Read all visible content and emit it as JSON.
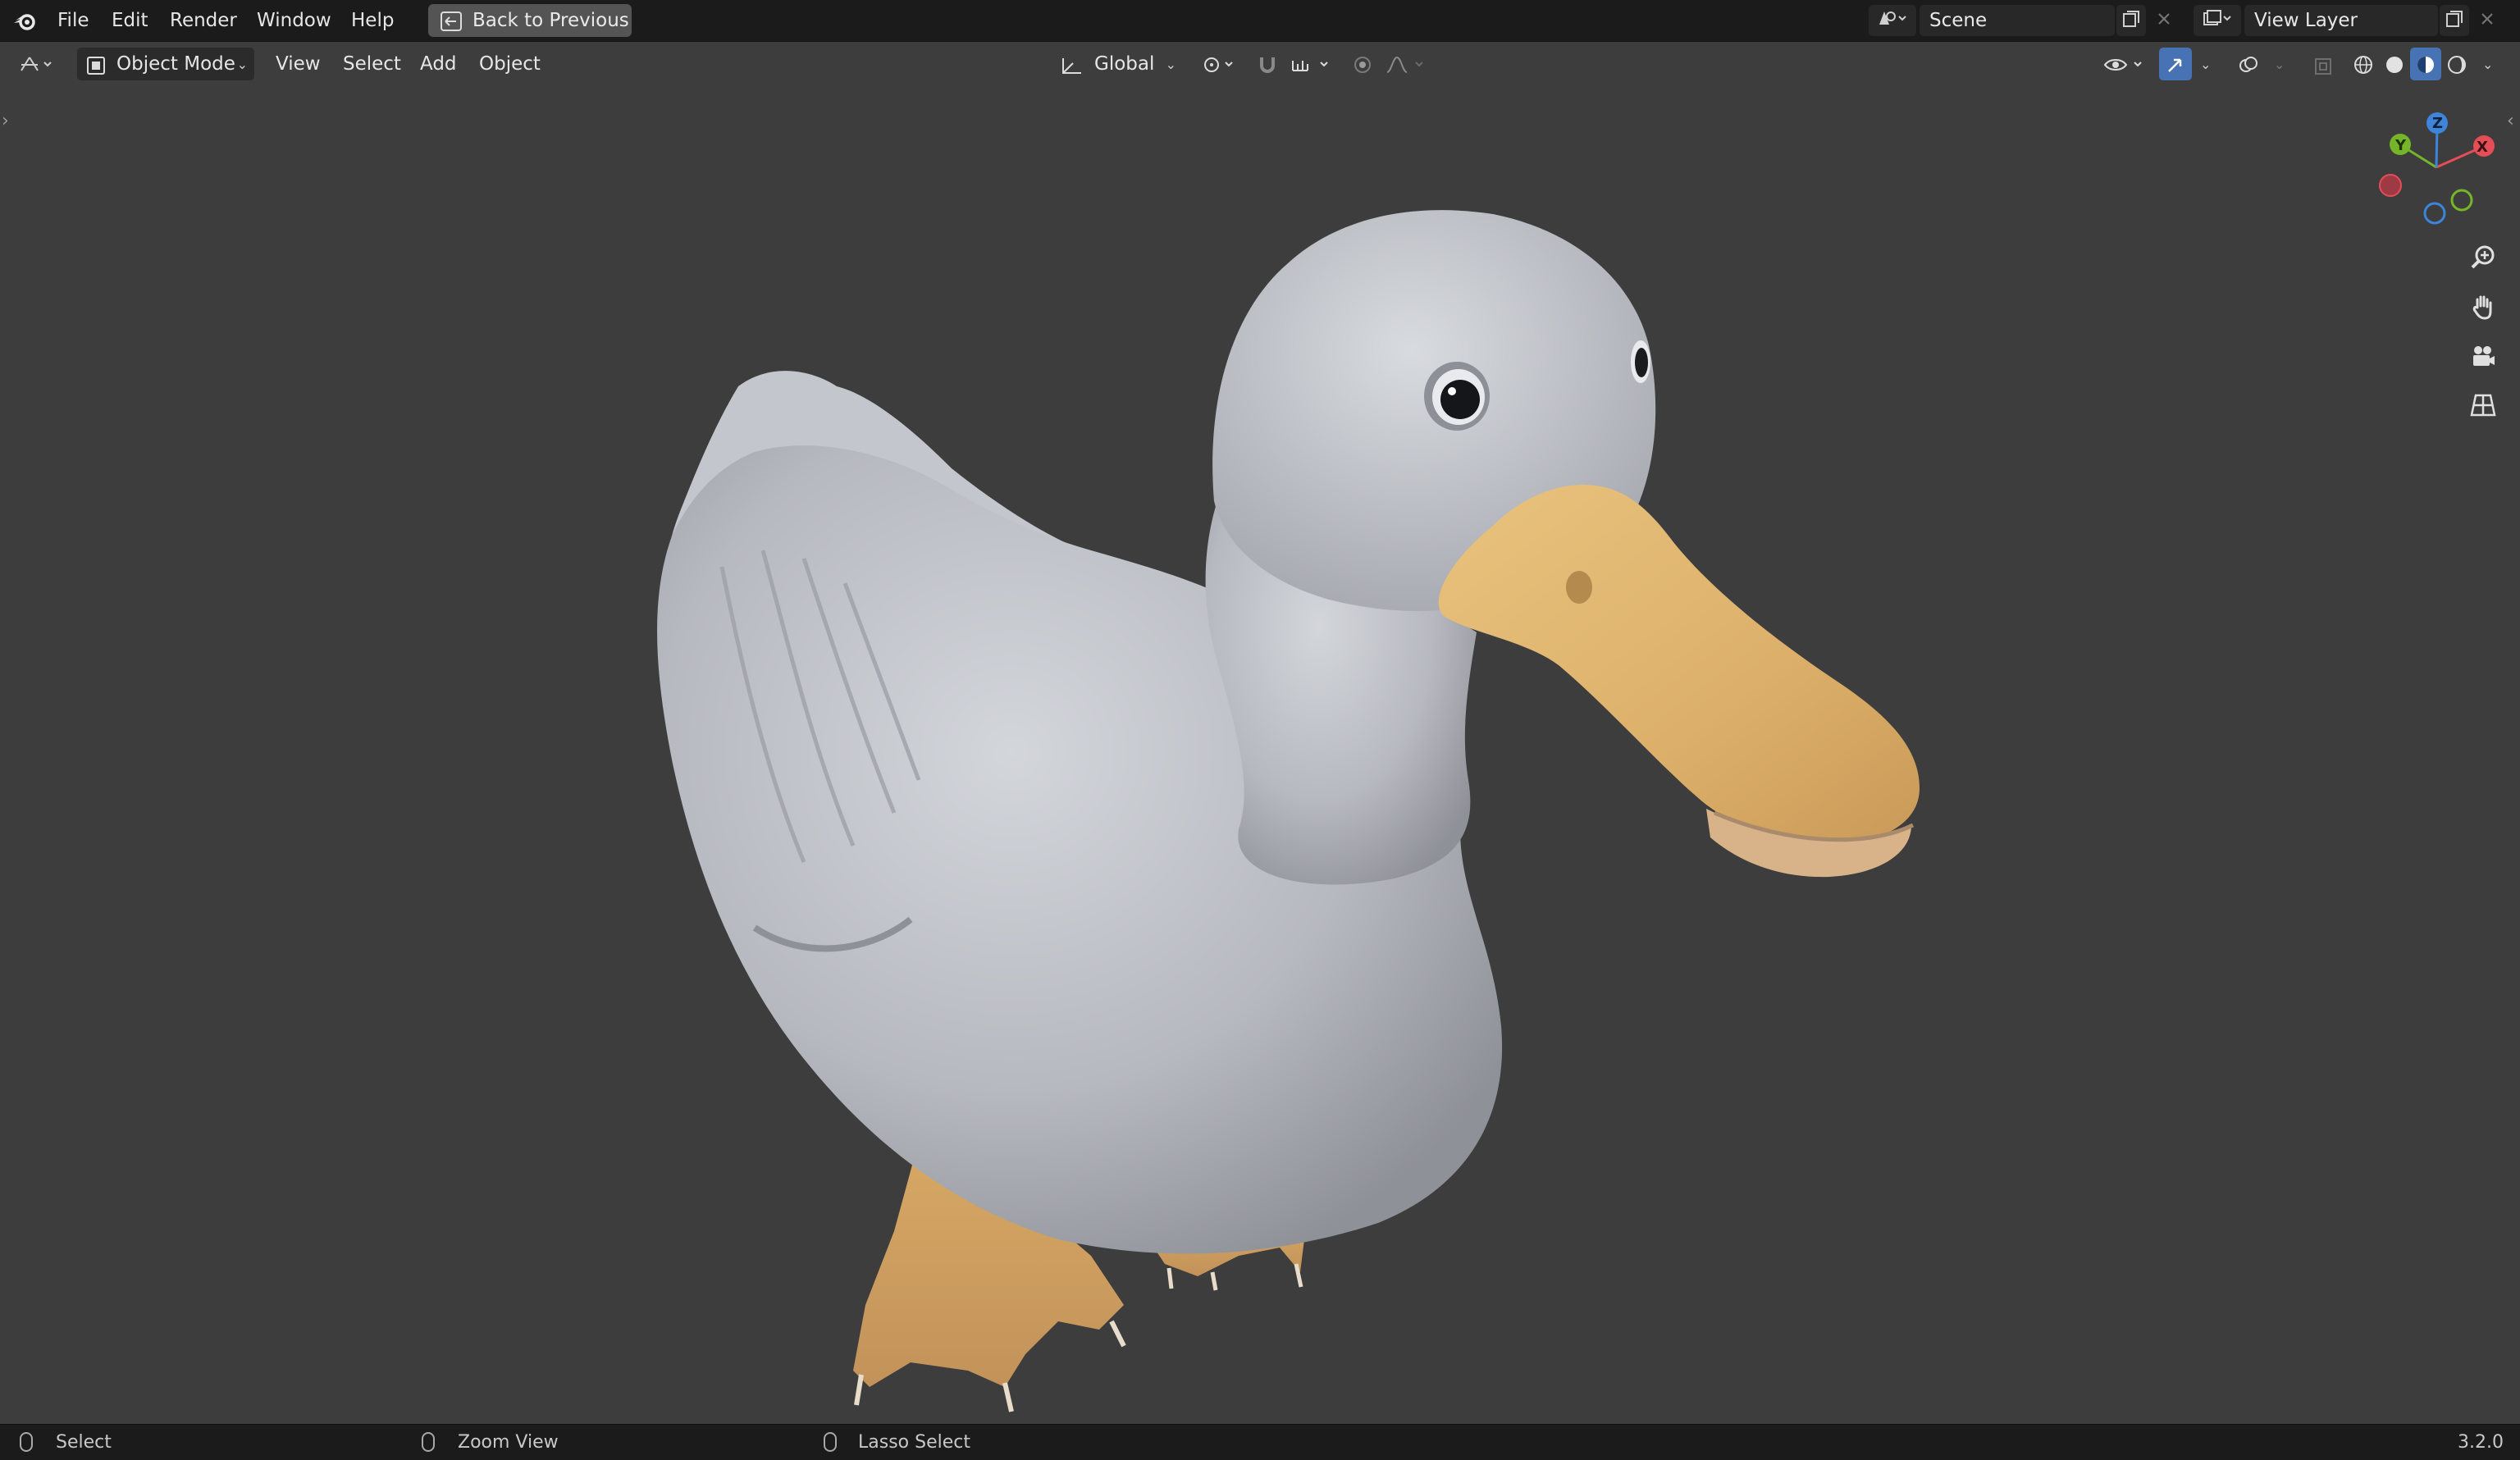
{
  "app": {
    "logo_icon": "blender-logo-icon",
    "version": "3.2.0"
  },
  "menu": [
    "File",
    "Edit",
    "Render",
    "Window",
    "Help"
  ],
  "back_button": {
    "label": "Back to Previous",
    "icon": "back-arrow-icon"
  },
  "scene": {
    "label": "Scene",
    "icon": "scene-icon"
  },
  "view_layer": {
    "label": "View Layer",
    "icon": "view-layer-icon"
  },
  "viewport_header": {
    "editor_type_icon": "3d-viewport-icon",
    "mode": "Object Mode",
    "menus": [
      "View",
      "Select",
      "Add",
      "Object"
    ],
    "transform_orientation": "Global",
    "shading_modes": [
      "wireframe",
      "solid",
      "material-preview",
      "rendered"
    ],
    "active_shading": "material-preview"
  },
  "navigation_gizmo": {
    "axes": [
      "X",
      "Y",
      "Z"
    ]
  },
  "nav_tools": [
    "zoom-icon",
    "hand-pan-icon",
    "camera-icon",
    "grid-icon"
  ],
  "status_bar": {
    "select": "Select",
    "zoom": "Zoom View",
    "lasso": "Lasso Select"
  },
  "colors": {
    "viewport_bg": "#3d3d3d",
    "header_bg": "#1b1b1b",
    "accent_blue": "#4772b3",
    "axis_x": "#e54d57",
    "axis_y": "#74b52a",
    "axis_z": "#3f84db"
  }
}
